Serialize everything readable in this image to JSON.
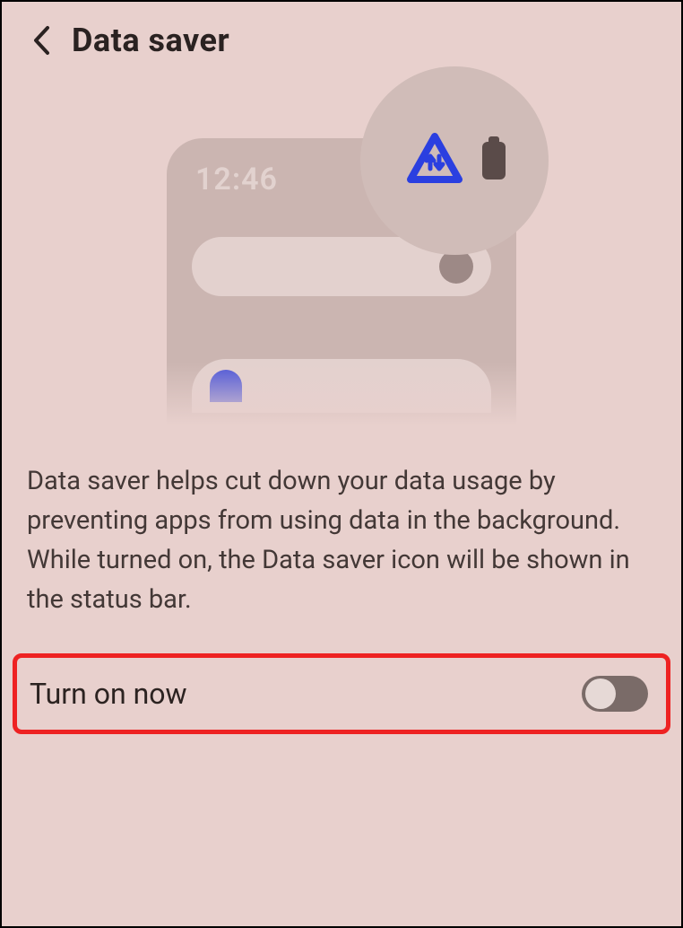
{
  "header": {
    "title": "Data saver"
  },
  "illustration": {
    "time": "12:46"
  },
  "description": "Data saver helps cut down your data usage by preventing apps from using data in the background. While turned on, the Data saver icon will be shown in the status bar.",
  "toggle": {
    "label": "Turn on now",
    "on": false
  },
  "colors": {
    "accent": "#2a3fe0",
    "highlight_border": "#e22020"
  }
}
